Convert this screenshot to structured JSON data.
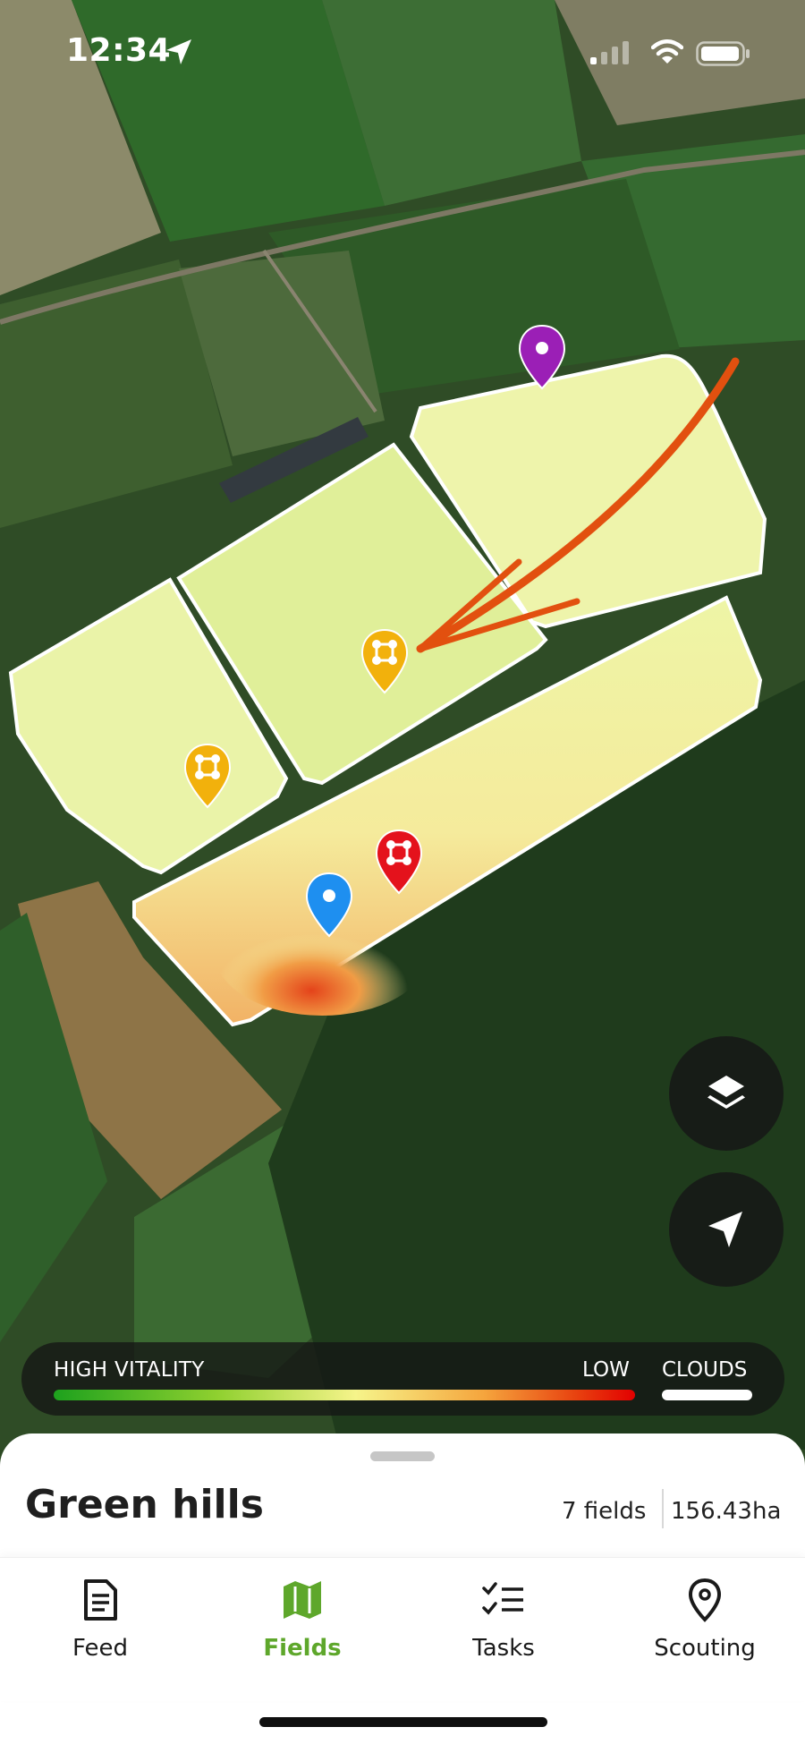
{
  "status_bar": {
    "time": "12:34"
  },
  "map": {
    "legend": {
      "high_label": "HIGH VITALITY",
      "low_label": "LOW",
      "clouds_label": "CLOUDS"
    },
    "pins": [
      {
        "color": "#9b1fb6",
        "icon": "dot-icon"
      },
      {
        "color": "#f2b10c",
        "icon": "field-boundary-icon"
      },
      {
        "color": "#f2b10c",
        "icon": "field-boundary-icon"
      },
      {
        "color": "#e4121c",
        "icon": "field-boundary-icon"
      },
      {
        "color": "#1e8ff0",
        "icon": "dot-icon"
      }
    ],
    "buttons": [
      "layers-icon",
      "navigation-arrow-icon"
    ]
  },
  "sheet": {
    "farm_name": "Green hills",
    "fields_count": "7 fields",
    "area": "156.43ha"
  },
  "tabs": [
    {
      "label": "Feed",
      "icon": "document-icon"
    },
    {
      "label": "Fields",
      "icon": "map-icon",
      "active": true
    },
    {
      "label": "Tasks",
      "icon": "checklist-icon"
    },
    {
      "label": "Scouting",
      "icon": "location-pin-icon"
    }
  ],
  "accent_color": "#5ea72b"
}
